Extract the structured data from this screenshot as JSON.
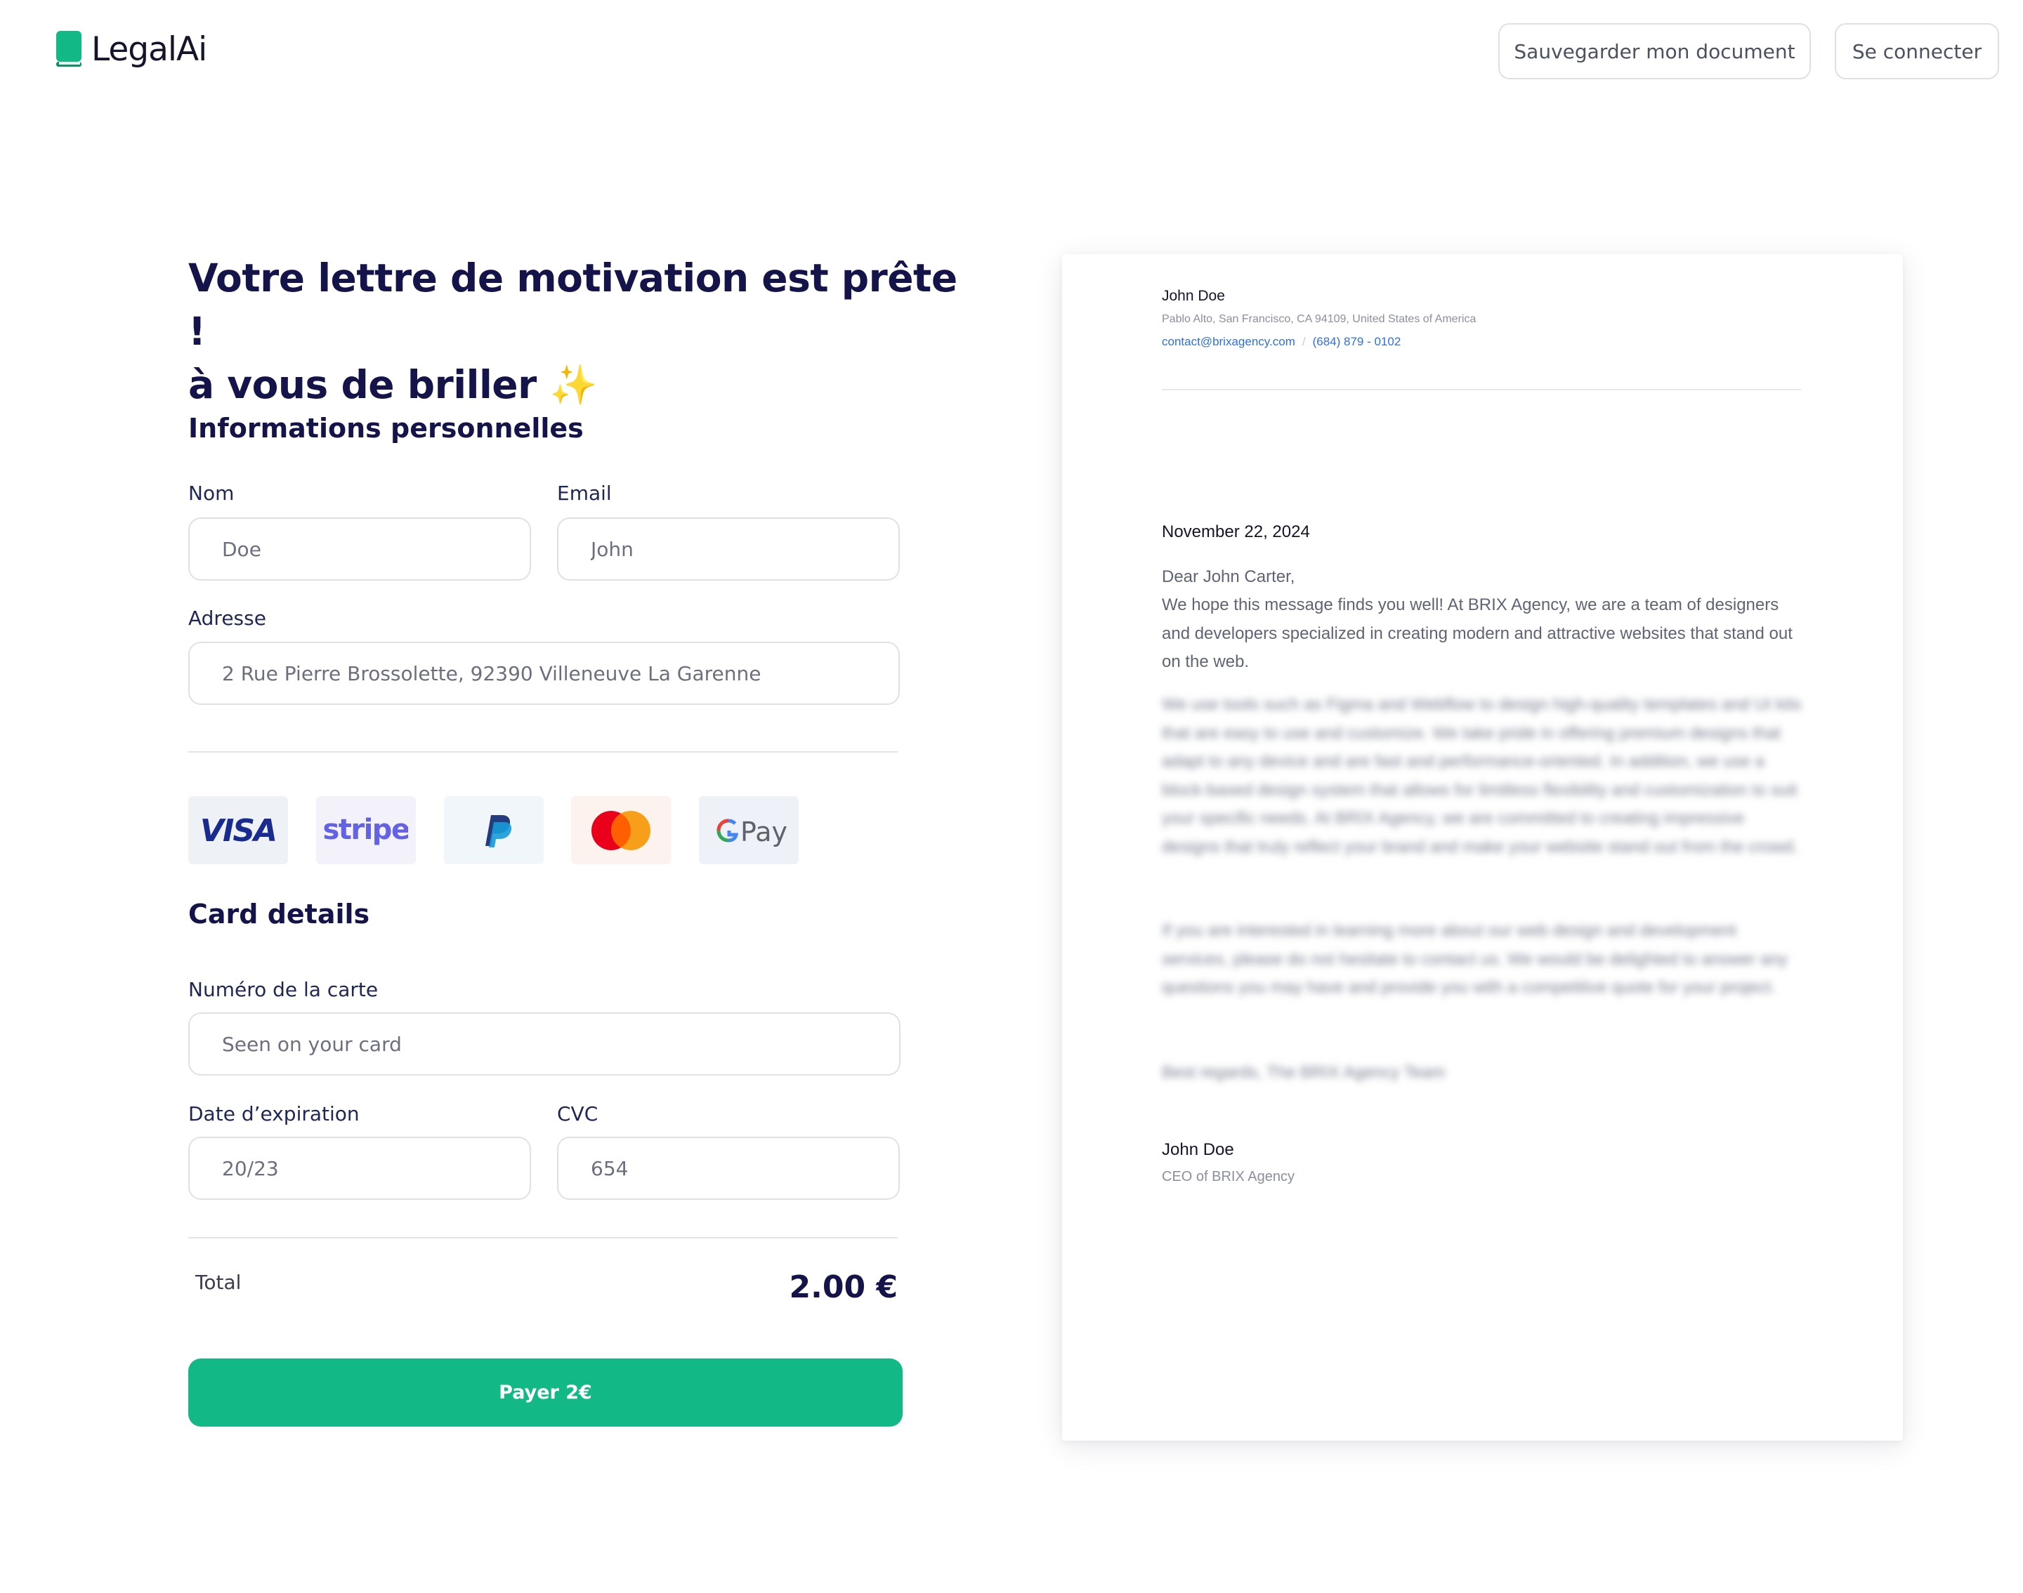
{
  "header": {
    "logo_text": "LegalAi",
    "save_button": "Sauvegarder mon document",
    "login_button": "Se connecter"
  },
  "headline": {
    "line1": "Votre lettre de motivation est prête !",
    "line2": "à vous de briller ✨"
  },
  "personal": {
    "title": "Informations personnelles",
    "nom_label": "Nom",
    "nom_placeholder": "Doe",
    "email_label": "Email",
    "email_placeholder": "John",
    "adresse_label": "Adresse",
    "adresse_placeholder": "2 Rue Pierre Brossolette, 92390 Villeneuve La Garenne"
  },
  "payment_methods": [
    "VISA",
    "stripe",
    "PayPal",
    "Mastercard",
    "G Pay"
  ],
  "card": {
    "title": "Card details",
    "number_label": "Numéro de la carte",
    "number_placeholder": "Seen on your card",
    "expiry_label": "Date d’expiration",
    "expiry_placeholder": "20/23",
    "cvc_label": "CVC",
    "cvc_placeholder": "654"
  },
  "total": {
    "label": "Total",
    "value": "2.00 €"
  },
  "pay_button": "Payer 2€",
  "letter": {
    "sender_name": "John Doe",
    "sender_address": "Pablo Alto, San Francisco, CA 94109, United States of America",
    "sender_email": "contact@brixagency.com",
    "sender_separator": "/",
    "sender_phone": "(684) 879 - 0102",
    "date": "November 22, 2024",
    "greeting": "Dear John Carter,",
    "intro": "We hope this message finds you well! At BRIX Agency, we are a team of designers and developers specialized in creating modern and attractive websites that stand out on the web.",
    "body1": "We use tools such as Figma and Webflow to design high-quality templates and UI kits that are easy to use and customize. We take pride in offering premium designs that adapt to any device and are fast and performance-oriented. In addition, we use a block-based design system that allows for limitless flexibility and customization to suit your specific needs. At BRIX Agency, we are committed to creating impressive designs that truly reflect your brand and make your website stand out from the crowd.",
    "body2": "If you are interested in learning more about our web design and development services, please do not hesitate to contact us. We would be delighted to answer any questions you may have and provide you with a competitive quote for your project.",
    "closing": "Best regards, The BRIX Agency Team",
    "sign_name": "John Doe",
    "sign_title": "CEO of BRIX Agency"
  },
  "colors": {
    "brand_green": "#12b886",
    "heading_navy": "#14134a",
    "link_blue": "#2f6fe4"
  }
}
